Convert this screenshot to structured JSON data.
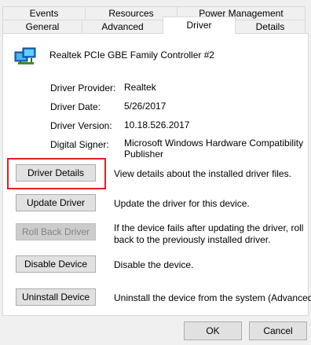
{
  "tabs": {
    "row_back": [
      "Events",
      "Resources",
      "Power Management"
    ],
    "row_front": [
      "General",
      "Advanced",
      "Driver",
      "Details"
    ],
    "active": "Driver"
  },
  "device": {
    "name": "Realtek PCIe GBE Family Controller #2",
    "icon": "network-adapter-icon"
  },
  "info": {
    "provider_label": "Driver Provider:",
    "provider_value": "Realtek",
    "date_label": "Driver Date:",
    "date_value": "5/26/2017",
    "version_label": "Driver Version:",
    "version_value": "10.18.526.2017",
    "signer_label": "Digital Signer:",
    "signer_line1": "Microsoft Windows Hardware Compatibility",
    "signer_line2": "Publisher"
  },
  "actions": {
    "details_label": "Driver Details",
    "details_desc": "View details about the installed driver files.",
    "update_label": "Update Driver",
    "update_desc": "Update the driver for this device.",
    "rollback_label": "Roll Back Driver",
    "rollback_desc1": "If the device fails after updating the driver, roll",
    "rollback_desc2": "back to the previously installed driver.",
    "disable_label": "Disable Device",
    "disable_desc": "Disable the device.",
    "uninstall_label": "Uninstall Device",
    "uninstall_desc": "Uninstall the device from the system (Advanced)."
  },
  "footer": {
    "ok_label": "OK",
    "cancel_label": "Cancel"
  },
  "colors": {
    "highlight": "#e01e25",
    "window_bg": "#f0f0f0",
    "panel_bg": "#ffffff"
  }
}
